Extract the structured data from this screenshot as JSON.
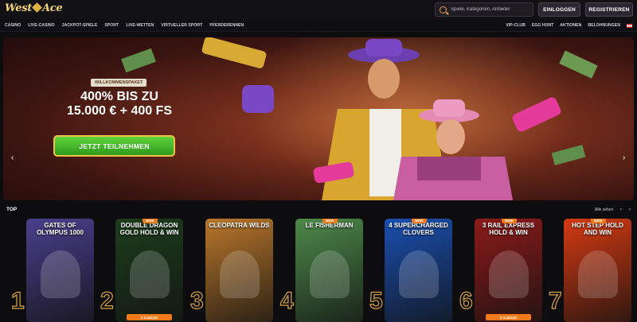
{
  "brand": {
    "logo_text_1": "West",
    "logo_text_2": "Ace"
  },
  "search": {
    "placeholder": "Spiele, Kategorien, Anbieter"
  },
  "auth": {
    "login_label": "EINLOGGEN",
    "register_label": "REGISTRIEREN"
  },
  "nav": {
    "left": [
      "CASINO",
      "LIVE-CASINO",
      "JACKPOT-SPIELE",
      "SPORT",
      "LIVE-WETTEN",
      "VIRTUELLER SPORT",
      "PFERDERENNEN"
    ],
    "right": [
      "VIP-CLUB",
      "EGG HUNT",
      "AKTIONEN",
      "BELOHNUNGEN"
    ]
  },
  "hero": {
    "badge": "WILLKOMMENSPAKET",
    "headline_line1": "400% BIS ZU",
    "headline_line2": "15.000 € + 400 FS",
    "cta_label": "JETZT TEILNEHMEN",
    "prev_arrow": "‹",
    "next_arrow": "›"
  },
  "top_section": {
    "title": "TOP",
    "see_all": "Alle sehen",
    "prev": "‹",
    "next": "›",
    "games": [
      {
        "rank": "1",
        "name": "GATES OF OLYMPUS 1000",
        "new": "",
        "jackpot": "",
        "bg": "#4a3f8c"
      },
      {
        "rank": "2",
        "name": "DOUBLE DRAGON GOLD HOLD & WIN",
        "new": "NEW",
        "jackpot": "€ 3.442,82",
        "bg": "#1d3d1c"
      },
      {
        "rank": "3",
        "name": "CLEOPATRA WILDS",
        "new": "",
        "jackpot": "",
        "bg": "#b9772b"
      },
      {
        "rank": "4",
        "name": "LE FISHERMAN",
        "new": "NEW",
        "jackpot": "",
        "bg": "#4d8a4a"
      },
      {
        "rank": "5",
        "name": "4 SUPERCHARGED CLOVERS",
        "new": "NEW",
        "jackpot": "",
        "bg": "#1a4fb0"
      },
      {
        "rank": "6",
        "name": "3 RAIL EXPRESS HOLD & WIN",
        "new": "NEW",
        "jackpot": "€ 3.442,82",
        "bg": "#8c1a1a"
      },
      {
        "rank": "7",
        "name": "HOT STEP HOLD AND WIN",
        "new": "NEW",
        "jackpot": "",
        "bg": "#d43a12"
      }
    ]
  }
}
